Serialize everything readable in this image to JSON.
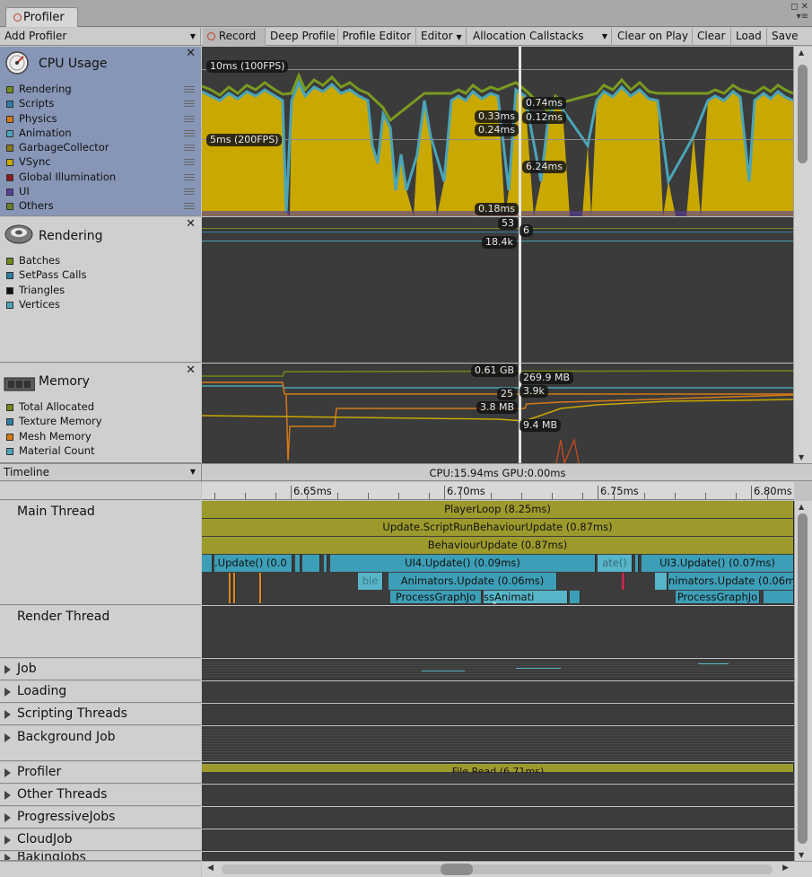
{
  "window": {
    "tab_title": "Profiler",
    "controls_glyph": "▾≡",
    "minmax_glyph": "◻ ✕"
  },
  "toolbar": {
    "add_profiler": "Add Profiler",
    "record": "Record",
    "deep_profile": "Deep Profile",
    "profile_editor": "Profile Editor",
    "target": "Editor",
    "allocation_callstacks": "Allocation Callstacks",
    "clear_on_play": "Clear on Play",
    "clear": "Clear",
    "load": "Load",
    "save": "Save"
  },
  "cpu": {
    "title": "CPU Usage",
    "legend": [
      {
        "label": "Rendering",
        "color": "#6f8a1b"
      },
      {
        "label": "Scripts",
        "color": "#2b7fa6"
      },
      {
        "label": "Physics",
        "color": "#d67a18"
      },
      {
        "label": "Animation",
        "color": "#4aa5b8"
      },
      {
        "label": "GarbageCollector",
        "color": "#8a7a1a"
      },
      {
        "label": "VSync",
        "color": "#c9a800"
      },
      {
        "label": "Global Illumination",
        "color": "#8b1a1a"
      },
      {
        "label": "UI",
        "color": "#5a3c9a"
      },
      {
        "label": "Others",
        "color": "#6a7f2a"
      }
    ],
    "labels": {
      "fps100": "10ms (100FPS)",
      "fps200": "5ms (200FPS)",
      "v1": "0.74ms",
      "v2": "0.33ms",
      "v3": "0.12ms",
      "v4": "0.24ms",
      "v5": "6.24ms",
      "v6": "0.18ms"
    }
  },
  "rendering": {
    "title": "Rendering",
    "legend": [
      {
        "label": "Batches",
        "color": "#6f8a1b"
      },
      {
        "label": "SetPass Calls",
        "color": "#2b7fa6"
      },
      {
        "label": "Triangles",
        "color": "#111111"
      },
      {
        "label": "Vertices",
        "color": "#4aa5b8"
      }
    ],
    "labels": {
      "batches": "53",
      "setpass": "6",
      "vertices": "18.4k"
    }
  },
  "memory": {
    "title": "Memory",
    "legend": [
      {
        "label": "Total Allocated",
        "color": "#6f8a1b"
      },
      {
        "label": "Texture Memory",
        "color": "#2b7fa6"
      },
      {
        "label": "Mesh Memory",
        "color": "#d67a18"
      },
      {
        "label": "Material Count",
        "color": "#4aa5b8"
      }
    ],
    "labels": {
      "total": "0.61 GB",
      "texture": "269.9 MB",
      "count": "25",
      "objects": "3.9k",
      "mesh": "3.8 MB",
      "other": "9.4 MB"
    }
  },
  "timeline": {
    "view_mode": "Timeline",
    "stats": "CPU:15.94ms   GPU:0.00ms",
    "ruler": [
      "6.65ms",
      "6.70ms",
      "6.75ms",
      "6.80ms"
    ],
    "threads": [
      {
        "name": "Main Thread",
        "expandable": false
      },
      {
        "name": "Render Thread",
        "expandable": false
      },
      {
        "name": "Job",
        "expandable": true
      },
      {
        "name": "Loading",
        "expandable": true
      },
      {
        "name": "Scripting Threads",
        "expandable": true
      },
      {
        "name": "Background Job",
        "expandable": true
      },
      {
        "name": "Profiler",
        "expandable": true
      },
      {
        "name": "Other Threads",
        "expandable": true
      },
      {
        "name": "ProgressiveJobs",
        "expandable": true
      },
      {
        "name": "CloudJob",
        "expandable": true
      },
      {
        "name": "BakingJobs",
        "expandable": true
      }
    ],
    "markers": {
      "playerloop": "PlayerLoop (8.25ms)",
      "scriptrun": "Update.ScriptRunBehaviourUpdate (0.87ms)",
      "behaviour": "BehaviourUpdate (0.87ms)",
      "ui_left": ".Update() (0.0",
      "ui4": "UI4.Update() (0.09ms)",
      "ui_mid": "ate()",
      "ui3": "UI3.Update() (0.07ms)",
      "anim_left": "ble",
      "animators": "Animators.Update (0.06ms)",
      "animators_right": "nimators.Update (0.06m",
      "pg1": "ProcessGraphJo",
      "pg_anim": "ssAnimati",
      "pg2": "ProcessGraphJo",
      "fileread": "File.Read (6.71ms)"
    }
  }
}
